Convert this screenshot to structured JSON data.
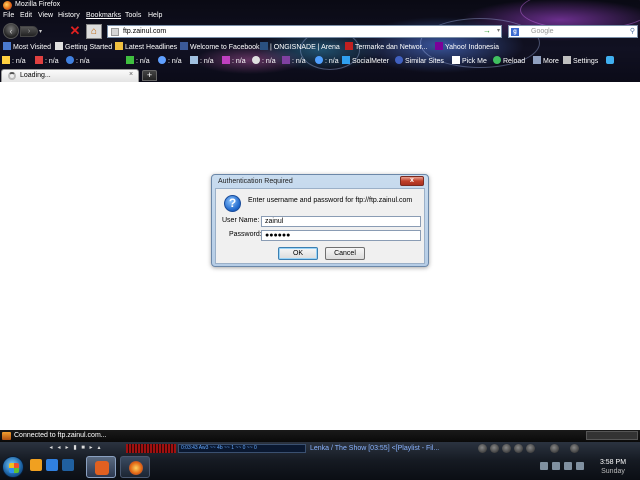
{
  "window": {
    "title": "Mozilla Firefox"
  },
  "menu": {
    "file": "File",
    "edit": "Edit",
    "view": "View",
    "history": "History",
    "bookmarks": "Bookmarks",
    "tools": "Tools",
    "help": "Help"
  },
  "nav": {
    "url": "ftp.zainul.com",
    "search_placeholder": "Google"
  },
  "bookmarks": [
    "Most Visited",
    "Getting Started",
    "Latest Headlines",
    "Welcome to Facebook",
    "| ONGISNADE | Arena",
    "Termarke dan Networ...",
    "Yahoo! Indonesia"
  ],
  "addons": {
    "na1": ": n/a",
    "na2": ": n/a",
    "na3": ": n/a",
    "na4": ": n/a",
    "na5": ": n/a",
    "na6": ": n/a",
    "na7": ": n/a",
    "na8": ": n/a",
    "na9": ": n/a",
    "na10": ": n/a",
    "na11": ": n/a",
    "socialmeter": "SocialMeter",
    "similar": "Similar Sites",
    "pickme": "Pick Me",
    "reload": "Reload",
    "more": "More",
    "settings": "Settings"
  },
  "tab": {
    "label": "Loading...",
    "new_tab": "+"
  },
  "dialog": {
    "title": "Authentication Required",
    "message": "Enter username and password for ftp://ftp.zainul.com",
    "username_label": "User Name:",
    "username_value": "zainul",
    "password_label": "Password:",
    "password_value": "●●●●●●",
    "ok": "OK",
    "cancel": "Cancel",
    "close": "x"
  },
  "status": {
    "text": "Connected to ftp.zainul.com..."
  },
  "media": {
    "display": "0:03:43  Aw3 ~~ 4b ~~ 1 ~~ 0 ~~ 0",
    "song": "Lenka / The Show [03:55]   <[Playlist - Fil..."
  },
  "clock": {
    "time": "3:58 PM",
    "day": "Sunday"
  }
}
